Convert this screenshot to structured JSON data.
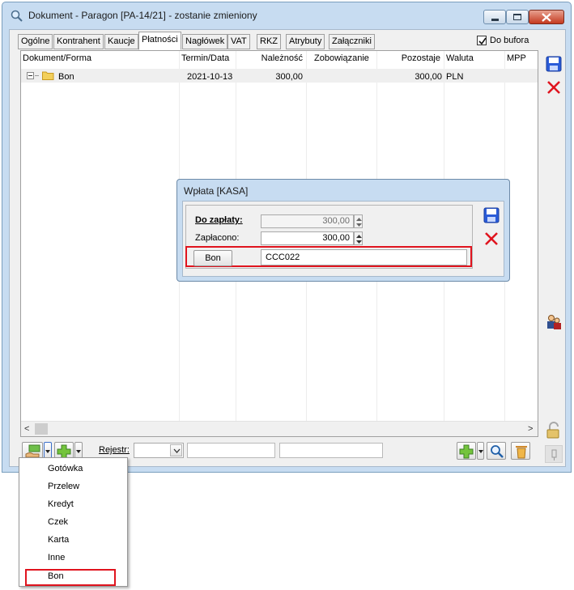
{
  "window": {
    "title": "Dokument - Paragon [PA-14/21]  - zostanie zmieniony"
  },
  "tabs": [
    {
      "label": "Ogólne",
      "active": false
    },
    {
      "label": "Kontrahent",
      "active": false
    },
    {
      "label": "Kaucje",
      "active": false
    },
    {
      "label": "Płatności",
      "active": true
    },
    {
      "label": "Nagłówek",
      "active": false
    },
    {
      "label": "VAT",
      "active": false
    },
    {
      "label": "RKZ",
      "active": false
    },
    {
      "label": "Atrybuty",
      "active": false
    },
    {
      "label": "Załączniki",
      "active": false
    }
  ],
  "do_bufora": {
    "label": "Do bufora",
    "checked": true
  },
  "grid": {
    "columns": [
      "Dokument/Forma",
      "Termin/Data",
      "Należność",
      "Zobowiązanie",
      "Pozostaje",
      "Waluta",
      "MPP"
    ],
    "rows": [
      {
        "name": "Bon",
        "date": "2021-10-13",
        "naleznosc": "300,00",
        "zobowiazanie": "",
        "pozostaje": "300,00",
        "waluta": "PLN",
        "mpp": ""
      }
    ]
  },
  "bottom_bar": {
    "rejestr_label": "Rejestr:"
  },
  "dialog": {
    "title": "Wpłata [KASA]",
    "do_zaplaty_label": "Do zapłaty:",
    "do_zaplaty_value": "300,00",
    "zaplacono_label": "Zapłacono:",
    "zaplacono_value": "300,00",
    "bon_button_label": "Bon",
    "bon_code": "CCC022"
  },
  "payment_menu": {
    "items": [
      "Gotówka",
      "Przelew",
      "Kredyt",
      "Czek",
      "Karta",
      "Inne",
      "Bon"
    ],
    "highlighted": "Bon"
  },
  "colors": {
    "highlight_red": "#e0141e",
    "window_frame": "#c7dcf1"
  }
}
